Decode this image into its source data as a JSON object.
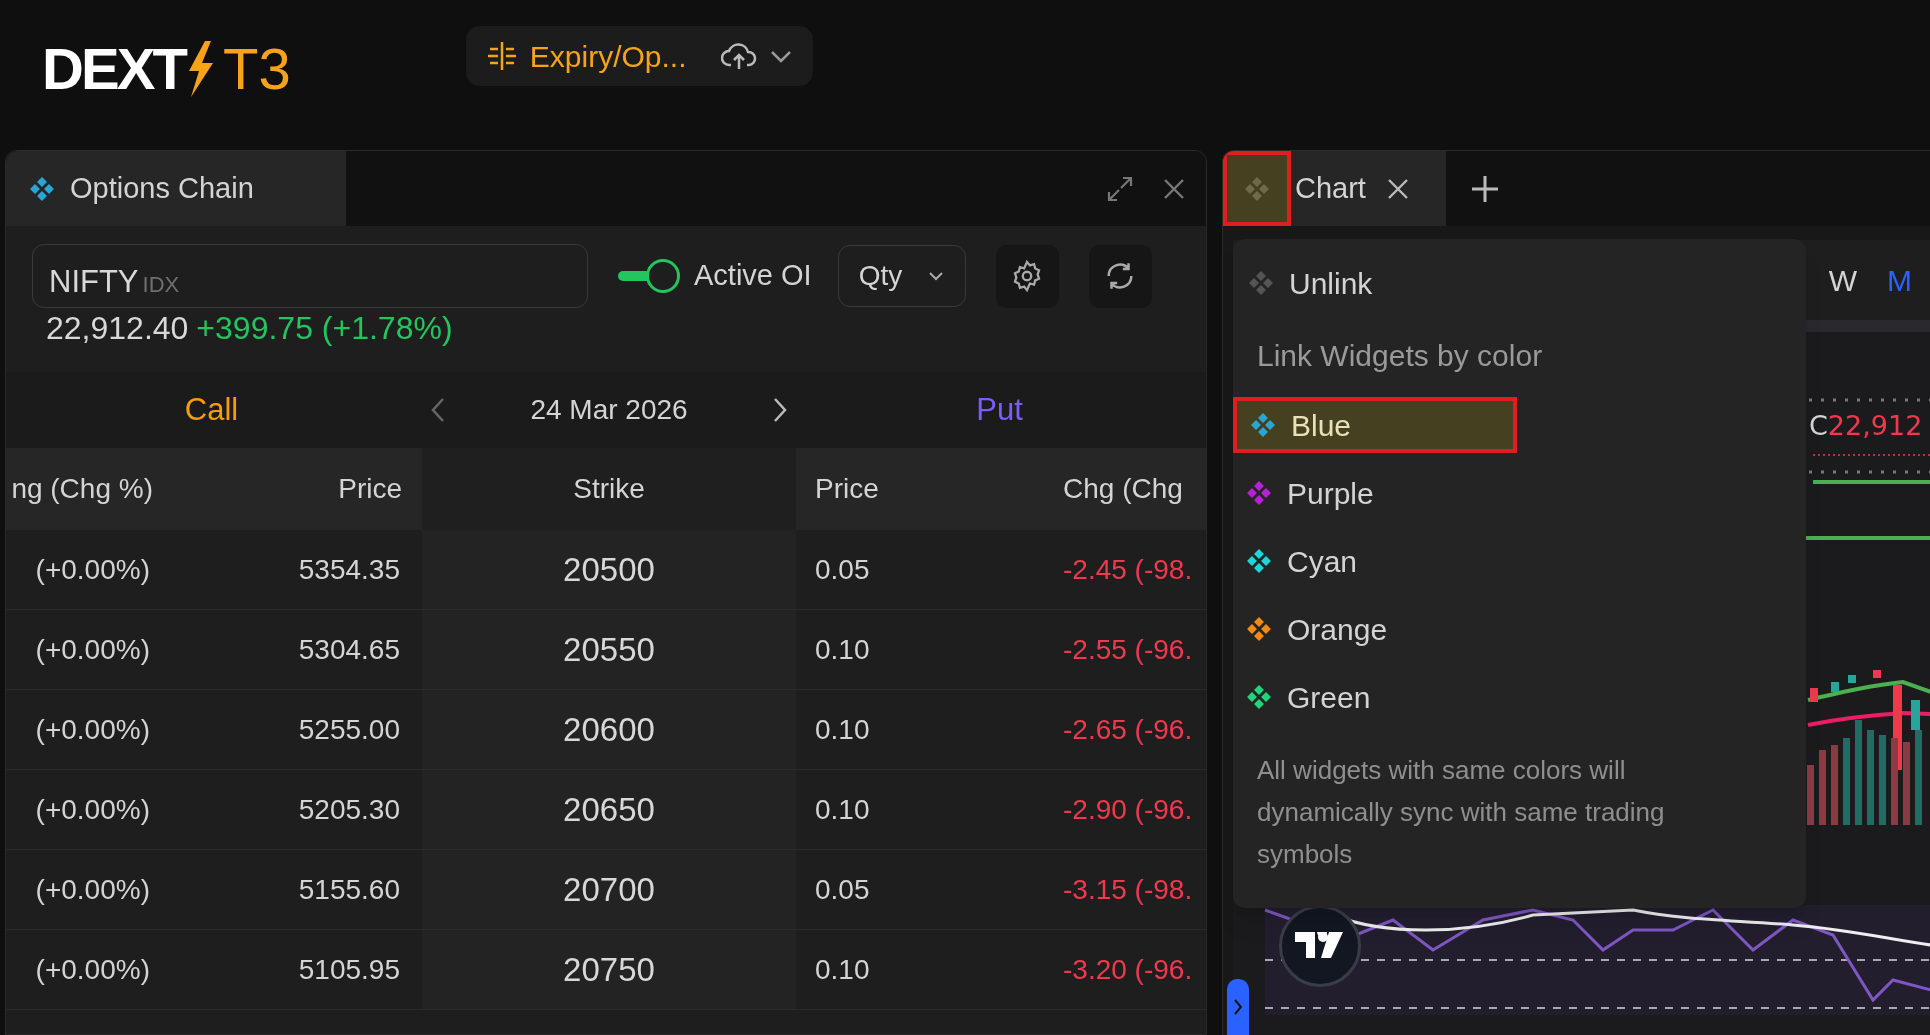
{
  "header": {
    "logo": {
      "name": "DEXT",
      "suffix": "T3"
    },
    "workspace": {
      "label": "Expiry/Op..."
    }
  },
  "options_chain": {
    "title": "Options Chain",
    "search": {
      "value": "NIFTY",
      "exchange": "IDX"
    },
    "active_oi": {
      "label": "Active OI",
      "on": true
    },
    "qty": {
      "label": "Qty"
    },
    "quote": {
      "price": "22,912.40",
      "change": "+399.75 (+1.78%)"
    },
    "call_label": "Call",
    "date": "24 Mar 2026",
    "put_label": "Put",
    "columns": [
      "ng (Chg %)",
      "Price",
      "Strike",
      "Price",
      "Chg (Chg"
    ],
    "rows": [
      {
        "call_chg": "(+0.00%)",
        "call_price": "5354.35",
        "strike": "20500",
        "put_price": "0.05",
        "put_chg": "-2.45 (-98."
      },
      {
        "call_chg": "(+0.00%)",
        "call_price": "5304.65",
        "strike": "20550",
        "put_price": "0.10",
        "put_chg": "-2.55 (-96."
      },
      {
        "call_chg": "(+0.00%)",
        "call_price": "5255.00",
        "strike": "20600",
        "put_price": "0.10",
        "put_chg": "-2.65 (-96."
      },
      {
        "call_chg": "(+0.00%)",
        "call_price": "5205.30",
        "strike": "20650",
        "put_price": "0.10",
        "put_chg": "-2.90 (-96."
      },
      {
        "call_chg": "(+0.00%)",
        "call_price": "5155.60",
        "strike": "20700",
        "put_price": "0.05",
        "put_chg": "-3.15 (-98."
      },
      {
        "call_chg": "(+0.00%)",
        "call_price": "5105.95",
        "strike": "20750",
        "put_price": "0.10",
        "put_chg": "-3.20 (-96."
      }
    ]
  },
  "chart": {
    "tab": {
      "title": "Chart"
    },
    "link_button": {
      "highlighted": true
    },
    "timeframes": [
      {
        "label": "W",
        "selected": false
      },
      {
        "label": "M",
        "selected": true
      }
    ],
    "last_close": {
      "prefix": "C",
      "value": "22,912"
    },
    "link_menu": {
      "unlink": "Unlink",
      "heading": "Link Widgets by color",
      "colors": [
        {
          "label": "Blue",
          "color": "#2aa6d6",
          "selected": true
        },
        {
          "label": "Purple",
          "color": "#b620d8",
          "selected": false
        },
        {
          "label": "Cyan",
          "color": "#1fd6d6",
          "selected": false
        },
        {
          "label": "Orange",
          "color": "#f08a12",
          "selected": false
        },
        {
          "label": "Green",
          "color": "#1fd67a",
          "selected": false
        }
      ],
      "note": "All widgets with same colors will dynamically sync with same trading symbols"
    }
  }
}
